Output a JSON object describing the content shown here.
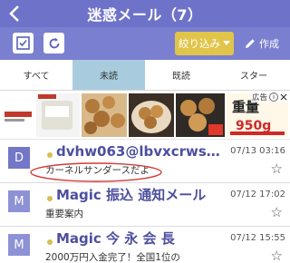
{
  "header": {
    "title": "迷惑メール（7）",
    "back_icon": "chevron-left-icon"
  },
  "toolbar": {
    "select_all_icon": "checkbox-icon",
    "refresh_icon": "refresh-icon",
    "filter_label": "絞り込み",
    "compose_label": "作成"
  },
  "tabs": [
    {
      "label": "すべて",
      "active": false
    },
    {
      "label": "未読",
      "active": true
    },
    {
      "label": "既読",
      "active": false
    },
    {
      "label": "スター",
      "active": false
    }
  ],
  "ad": {
    "label": "広告"
  },
  "messages": [
    {
      "avatar": "D",
      "sender": "dvhw063@lbvxcrwsxmr…",
      "date": "07/13 03:16",
      "preview": "カーネルサンダースだよ",
      "unread": true
    },
    {
      "avatar": "M",
      "sender": "Magic 振込 通知メール",
      "date": "07/12 17:02",
      "preview": "重要案内",
      "unread": true
    },
    {
      "avatar": "M",
      "sender": "Magic 今 永 会 長",
      "date": "07/12 15:55",
      "preview": "2000万円入金完了！全国1位の",
      "unread": true
    }
  ],
  "colors": {
    "header": "#6e72c9",
    "toolbar": "#7a7fcf",
    "filter": "#e0c54a",
    "active_tab": "#a8ccdd",
    "sender": "#4d4fa0",
    "unread_dot": "#d4bf53",
    "annotation": "#d23a3a"
  }
}
